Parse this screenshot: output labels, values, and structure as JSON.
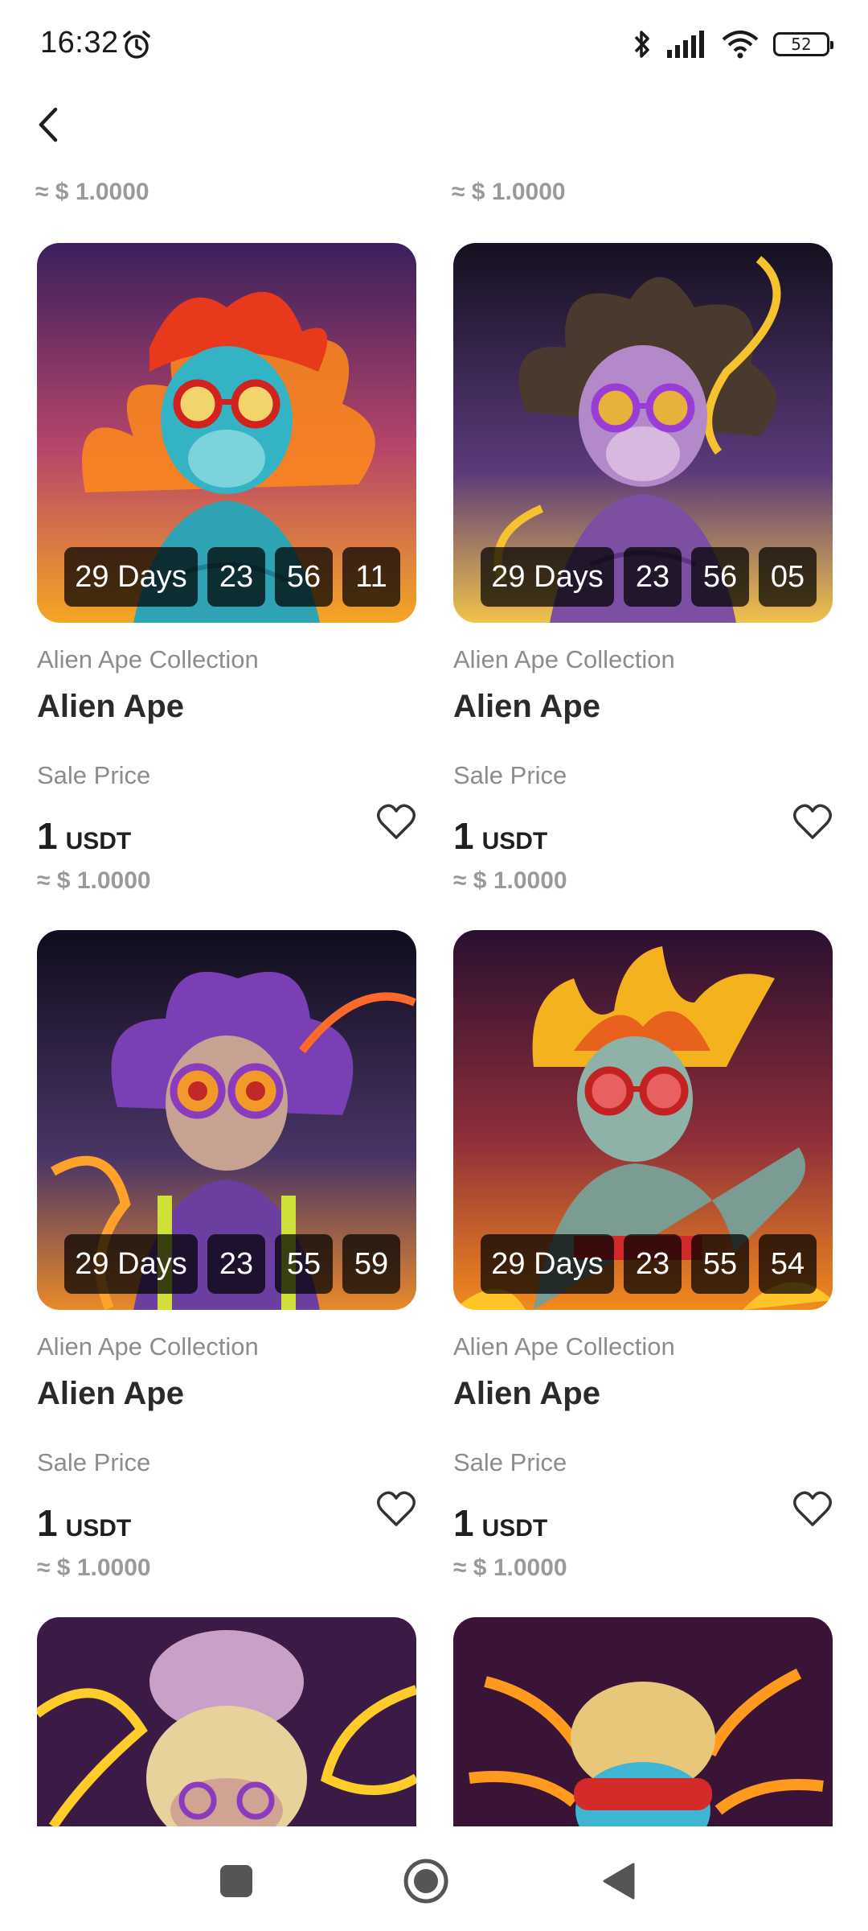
{
  "status_bar": {
    "time": "16:32",
    "battery": "52",
    "icons": [
      "alarm-icon",
      "bluetooth-icon",
      "signal-icon",
      "wifi-icon",
      "battery-icon"
    ]
  },
  "header": {
    "back_icon": "chevron-left-icon"
  },
  "top_partial": {
    "left_usd": "≈ $ 1.0000",
    "right_usd": "≈ $ 1.0000"
  },
  "cards": [
    {
      "days": "29 Days",
      "h": "23",
      "m": "56",
      "s": "11",
      "collection": "Alien Ape Collection",
      "title": "Alien Ape",
      "sale_label": "Sale Price",
      "amount": "1",
      "currency": "USDT",
      "usd": "≈ $ 1.0000"
    },
    {
      "days": "29 Days",
      "h": "23",
      "m": "56",
      "s": "05",
      "collection": "Alien Ape Collection",
      "title": "Alien Ape",
      "sale_label": "Sale Price",
      "amount": "1",
      "currency": "USDT",
      "usd": "≈ $ 1.0000"
    },
    {
      "days": "29 Days",
      "h": "23",
      "m": "55",
      "s": "59",
      "collection": "Alien Ape Collection",
      "title": "Alien Ape",
      "sale_label": "Sale Price",
      "amount": "1",
      "currency": "USDT",
      "usd": "≈ $ 1.0000"
    },
    {
      "days": "29 Days",
      "h": "23",
      "m": "55",
      "s": "54",
      "collection": "Alien Ape Collection",
      "title": "Alien Ape",
      "sale_label": "Sale Price",
      "amount": "1",
      "currency": "USDT",
      "usd": "≈ $ 1.0000"
    }
  ],
  "colors": {
    "accent_text": "#1f1f1f",
    "muted_text": "#8c8c8c",
    "price_muted": "#9a9a9a",
    "timer_bg": "#000000b8"
  },
  "nav_bar": {
    "icons": [
      "recents-square-icon",
      "home-circle-icon",
      "back-triangle-icon"
    ]
  }
}
